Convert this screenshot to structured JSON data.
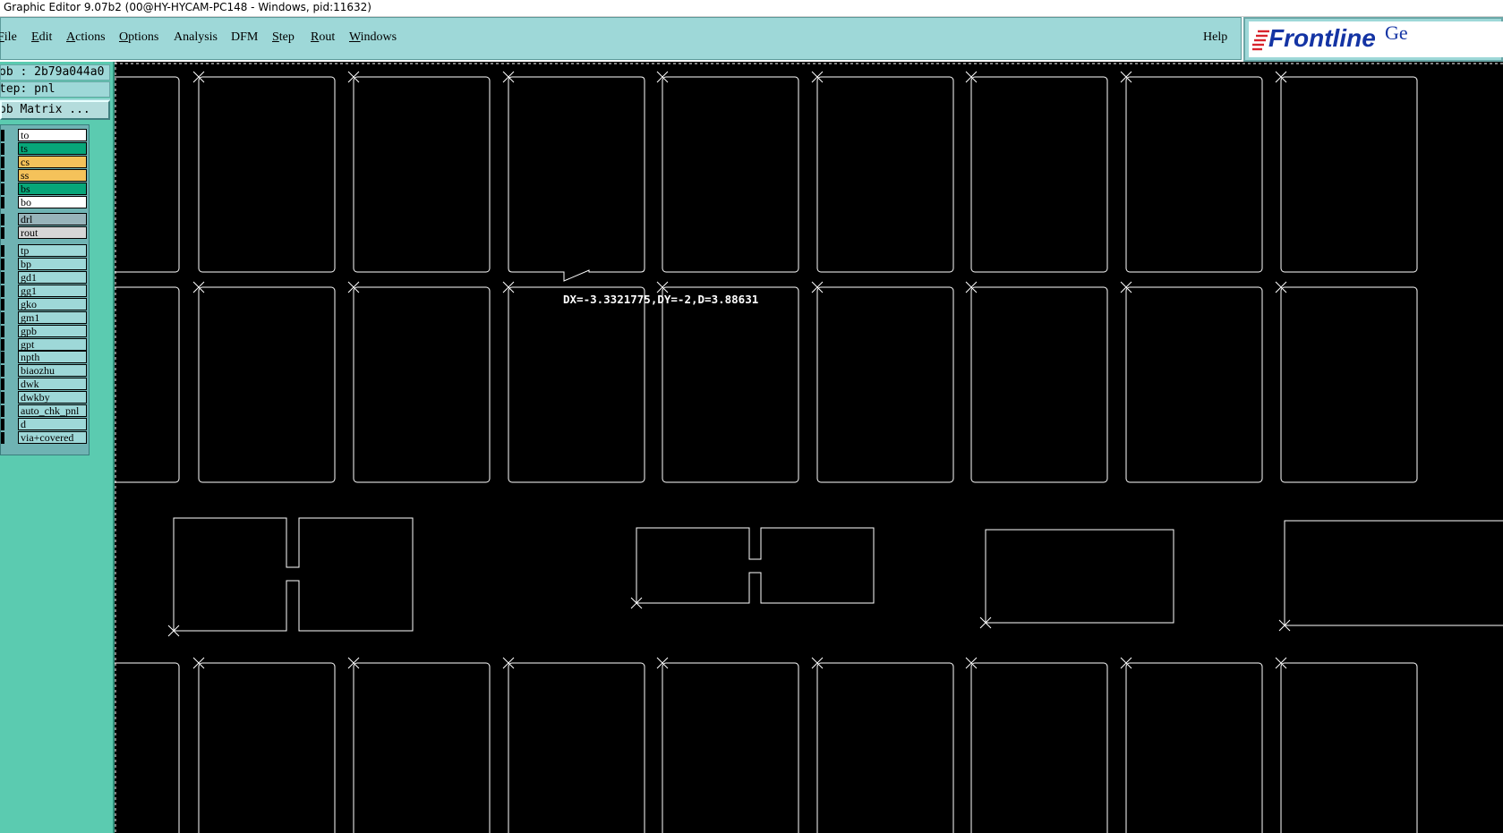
{
  "window": {
    "title": "Graphic Editor 9.07b2 (00@HY-HYCAM-PC148 - Windows, pid:11632)"
  },
  "menu": {
    "items": [
      {
        "label": "File",
        "underline": "F"
      },
      {
        "label": "Edit",
        "underline": "E"
      },
      {
        "label": "Actions",
        "underline": "A"
      },
      {
        "label": "Options",
        "underline": "O"
      },
      {
        "label": "Analysis",
        "underline": ""
      },
      {
        "label": "DFM",
        "underline": ""
      },
      {
        "label": "Step",
        "underline": "S"
      },
      {
        "label": "Rout",
        "underline": "R"
      },
      {
        "label": "Windows",
        "underline": "W"
      }
    ],
    "help": "Help"
  },
  "logo": {
    "text": "Frontline",
    "suffix": "Ge",
    "color": "#1434a4",
    "stripe_color": "#d8242c"
  },
  "info": {
    "job": "ob : 2b79a044a0",
    "step": "tep: pnl",
    "matrix_button": "ob Matrix ..."
  },
  "layers": [
    {
      "name": "to",
      "color": "#ffffff"
    },
    {
      "name": "ts",
      "color": "#07a679"
    },
    {
      "name": "cs",
      "color": "#f5c25a"
    },
    {
      "name": "ss",
      "color": "#f5c25a"
    },
    {
      "name": "bs",
      "color": "#07a679"
    },
    {
      "name": "bo",
      "color": "#ffffff"
    },
    {
      "name": "drl",
      "color": "#98b4ba"
    },
    {
      "name": "rout",
      "color": "#d6d6d6"
    },
    {
      "name": "tp",
      "color": "#9ed8d8"
    },
    {
      "name": "bp",
      "color": "#9ed8d8"
    },
    {
      "name": "gd1",
      "color": "#9ed8d8"
    },
    {
      "name": "gg1",
      "color": "#9ed8d8"
    },
    {
      "name": "gko",
      "color": "#9ed8d8"
    },
    {
      "name": "gm1",
      "color": "#9ed8d8"
    },
    {
      "name": "gpb",
      "color": "#9ed8d8"
    },
    {
      "name": "gpt",
      "color": "#9ed8d8"
    },
    {
      "name": "npth",
      "color": "#9ed8d8"
    },
    {
      "name": "biaozhu",
      "color": "#9ed8d8"
    },
    {
      "name": "dwk",
      "color": "#9ed8d8"
    },
    {
      "name": "dwkby",
      "color": "#9ed8d8"
    },
    {
      "name": "auto_chk_pnl",
      "color": "#9ed8d8"
    },
    {
      "name": "d",
      "color": "#9ed8d8"
    },
    {
      "name": "via+covered",
      "color": "#9ed8d8"
    }
  ],
  "canvas": {
    "measurement": "DX=-3.3321775,DY=-2,D=3.88631",
    "background": "#000000",
    "stroke": "#ffffff"
  }
}
